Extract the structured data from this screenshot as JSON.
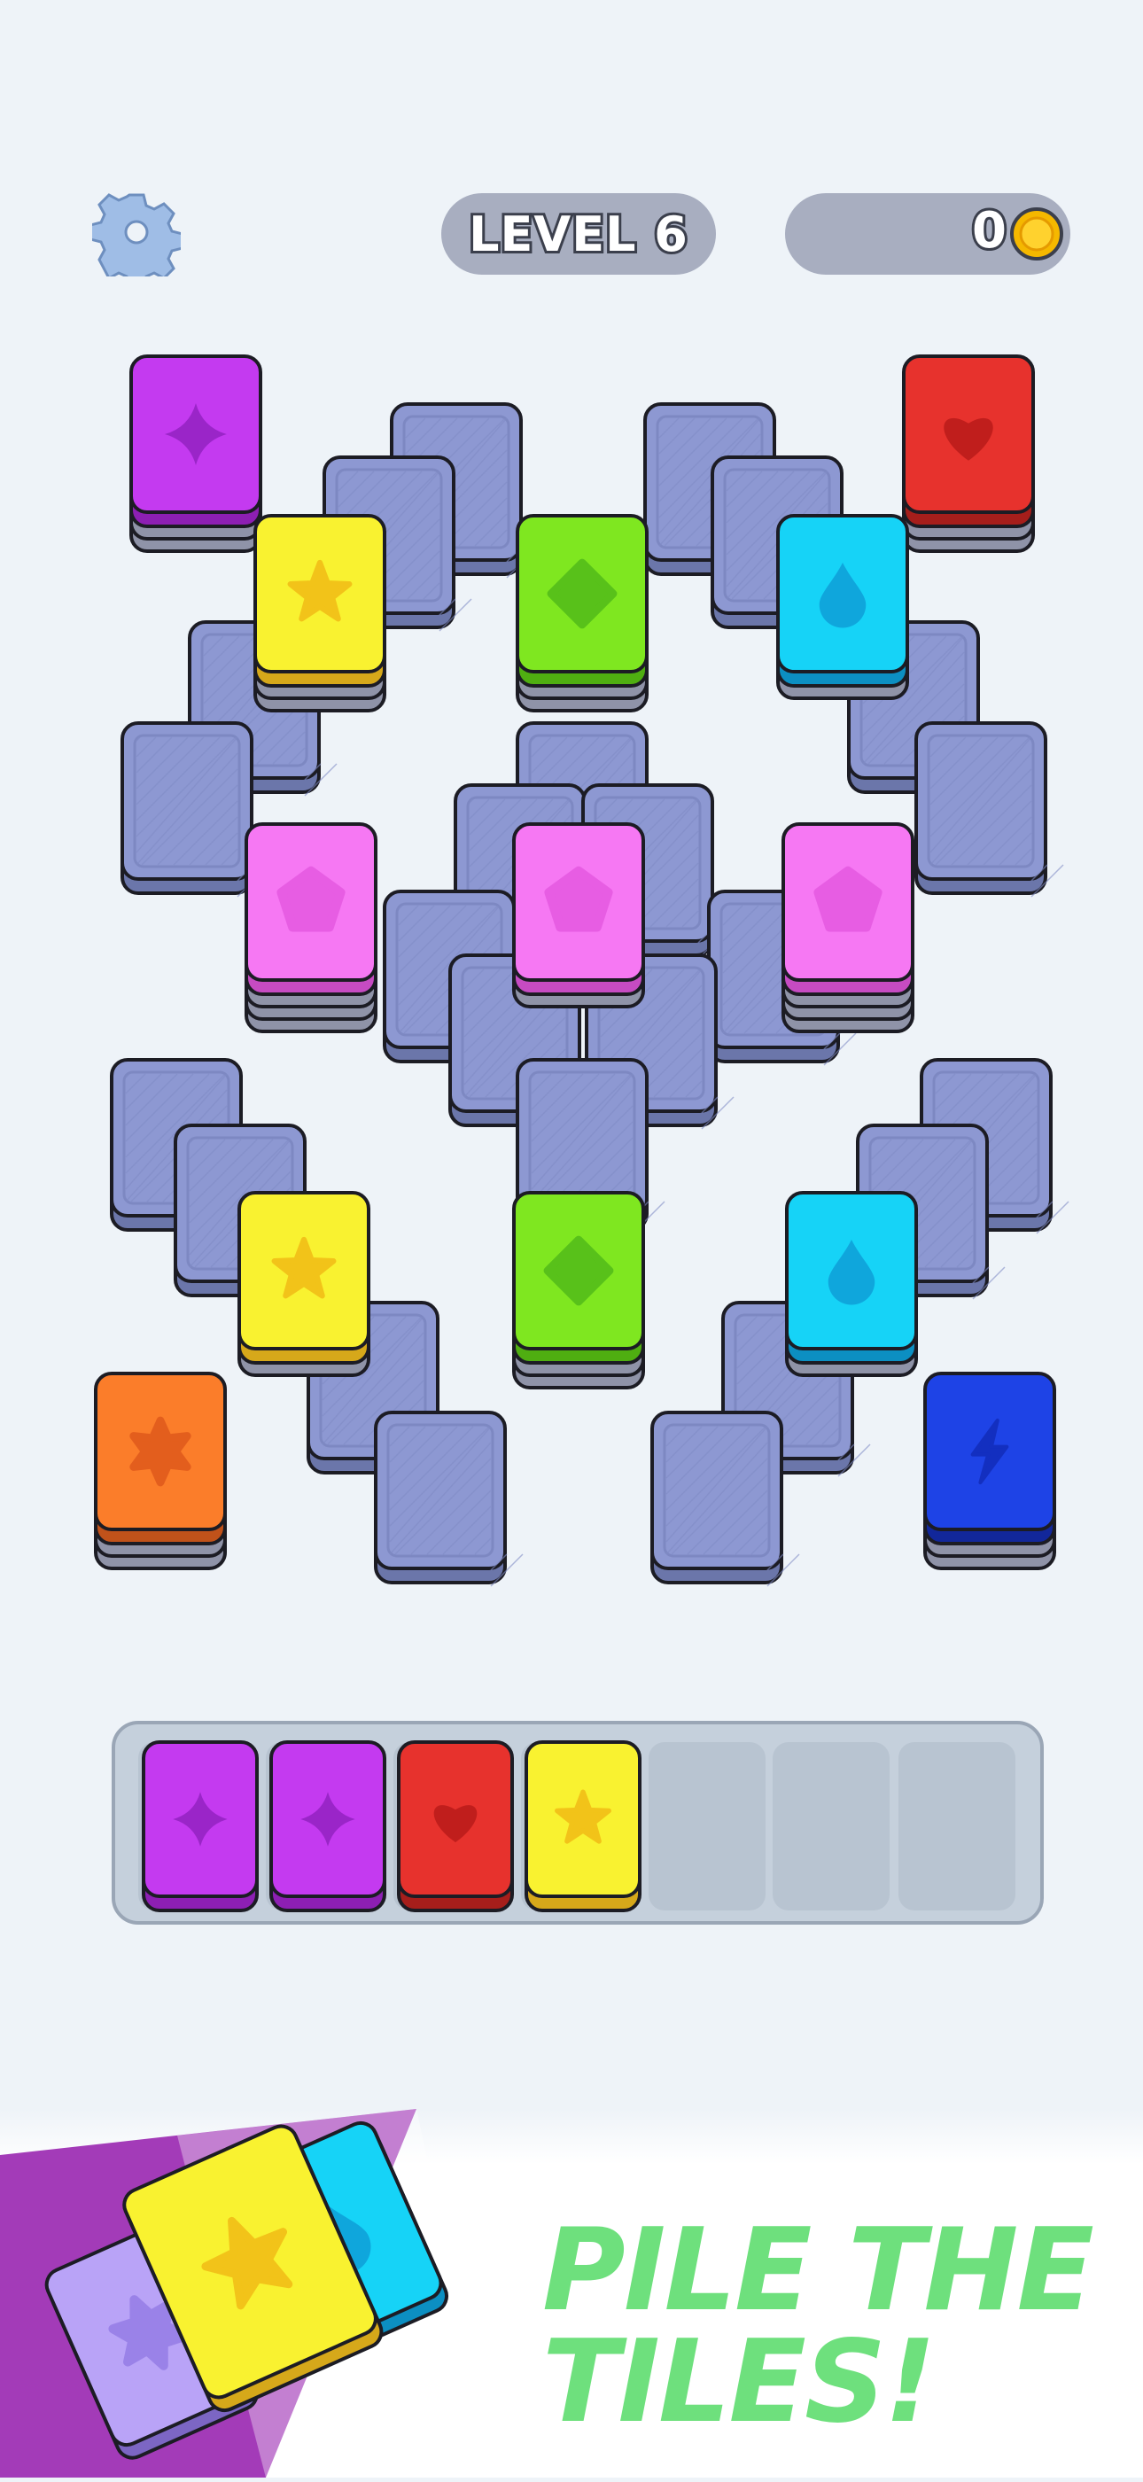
{
  "hud": {
    "level_label": "LEVEL 6",
    "coin_count": "0",
    "settings_icon": "gear-icon",
    "coin_icon": "coin-icon"
  },
  "colors": {
    "purple": "#c43af0",
    "red": "#e7322d",
    "yellow": "#f9f230",
    "green": "#7fe720",
    "cyan": "#16d3f7",
    "pink": "#f678f3",
    "orange": "#fb7d2a",
    "blue": "#1e43e6",
    "covered": "#8d98d2",
    "background": "#eef3f8",
    "banner_text": "#6ee07d"
  },
  "board": {
    "tiles": [
      {
        "symbol": "sparkle-icon",
        "color": "purple"
      },
      {
        "symbol": "heart-icon",
        "color": "red"
      },
      {
        "symbol": "star-icon",
        "color": "yellow"
      },
      {
        "symbol": "diamond-icon",
        "color": "green"
      },
      {
        "symbol": "drop-icon",
        "color": "cyan"
      },
      {
        "symbol": "pentagon-icon",
        "color": "pink"
      },
      {
        "symbol": "pentagon-icon",
        "color": "pink"
      },
      {
        "symbol": "pentagon-icon",
        "color": "pink"
      },
      {
        "symbol": "star-icon",
        "color": "yellow"
      },
      {
        "symbol": "diamond-icon",
        "color": "green"
      },
      {
        "symbol": "drop-icon",
        "color": "cyan"
      },
      {
        "symbol": "flower-icon",
        "color": "orange"
      },
      {
        "symbol": "lightning-icon",
        "color": "blue"
      }
    ]
  },
  "tray": {
    "slot_count": 7,
    "tiles": [
      {
        "symbol": "sparkle-icon",
        "color": "purple"
      },
      {
        "symbol": "sparkle-icon",
        "color": "purple"
      },
      {
        "symbol": "heart-icon",
        "color": "red"
      },
      {
        "symbol": "star-icon",
        "color": "yellow"
      }
    ]
  },
  "banner": {
    "text": "PILE THE\nTILES!",
    "tiles": [
      {
        "symbol": "flower-icon",
        "color": "lavender"
      },
      {
        "symbol": "drop-icon",
        "color": "cyan"
      },
      {
        "symbol": "star-icon",
        "color": "yellow"
      }
    ]
  }
}
